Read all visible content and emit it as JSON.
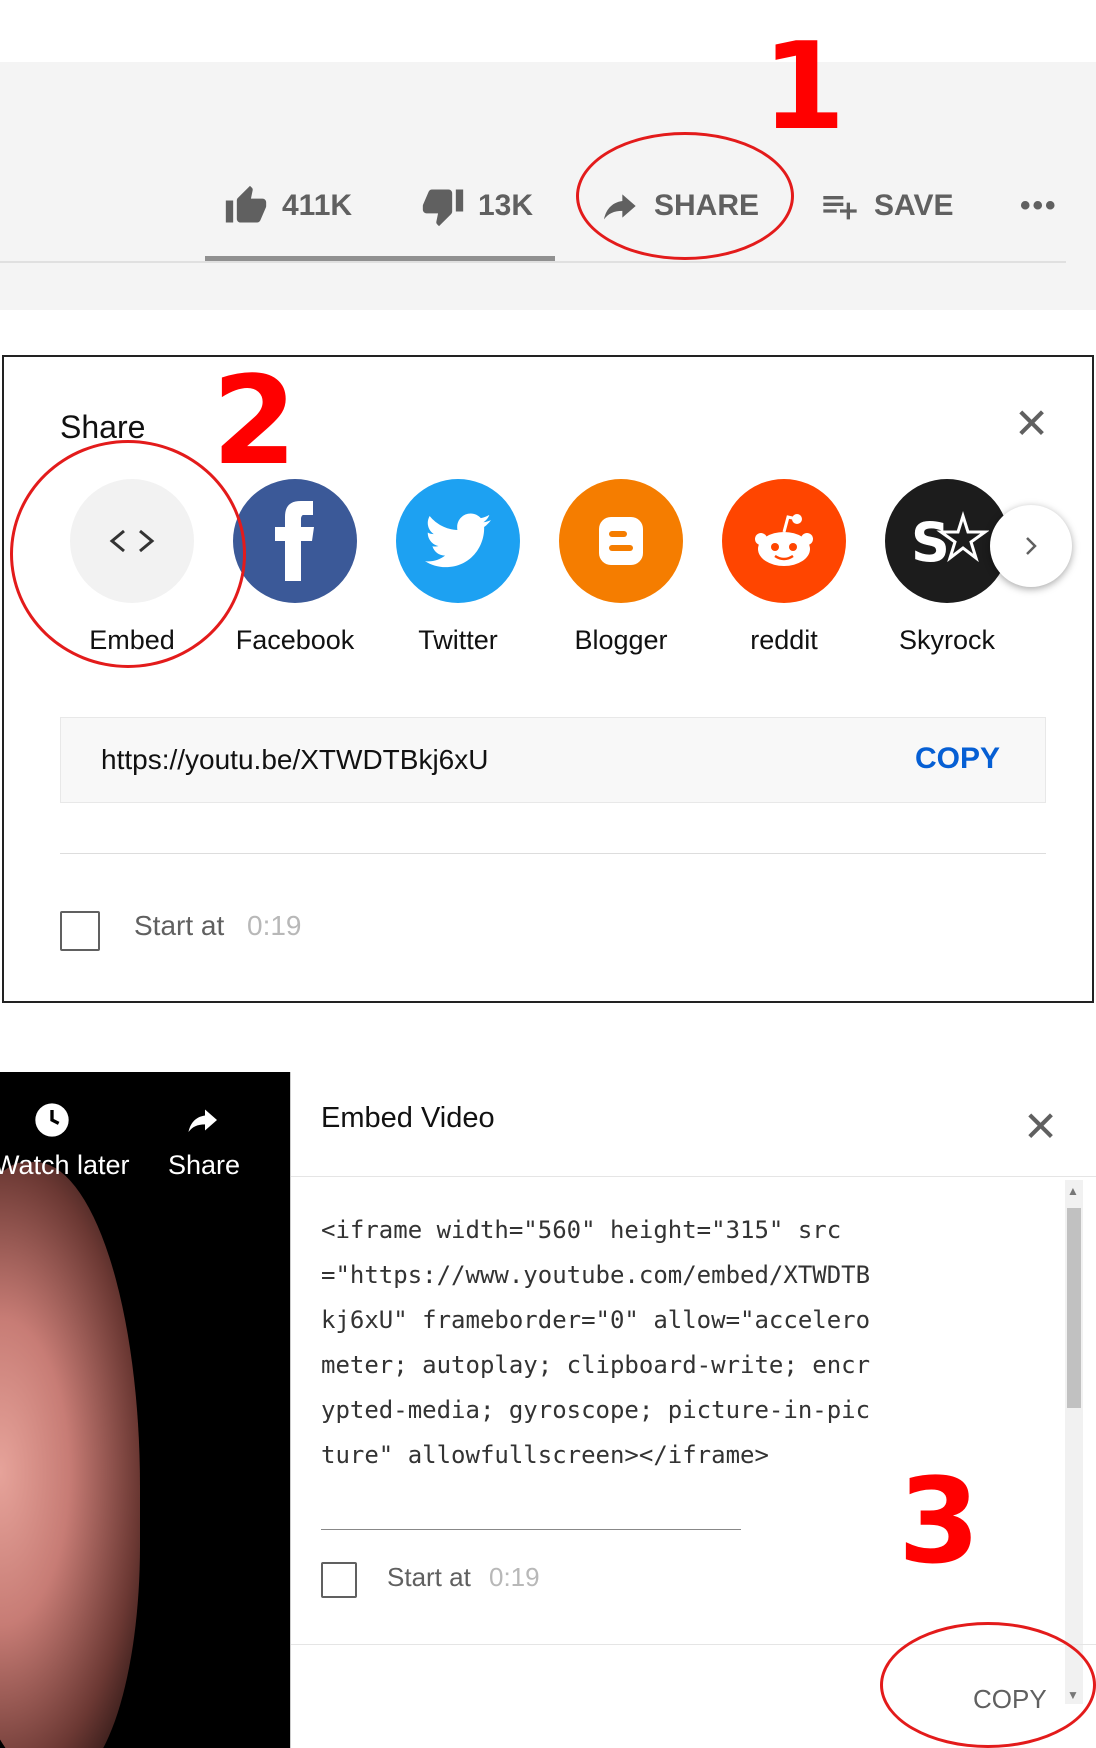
{
  "panel1": {
    "likes": "411K",
    "dislikes": "13K",
    "share_label": "SHARE",
    "save_label": "SAVE",
    "more_label": "•••"
  },
  "share_dialog": {
    "title": "Share",
    "close": "✕",
    "services": [
      {
        "label": "Embed",
        "icon": "embed-code-icon",
        "color": "#f2f2f2"
      },
      {
        "label": "Facebook",
        "icon": "facebook-icon",
        "color": "#3b5998"
      },
      {
        "label": "Twitter",
        "icon": "twitter-icon",
        "color": "#1da1f2"
      },
      {
        "label": "Blogger",
        "icon": "blogger-icon",
        "color": "#f57d00"
      },
      {
        "label": "reddit",
        "icon": "reddit-icon",
        "color": "#ff4500"
      },
      {
        "label": "Skyrock",
        "icon": "skyrock-icon",
        "color": "#1c1c1c"
      }
    ],
    "url": "https://youtu.be/XTWDTBkj6xU",
    "copy_label": "COPY",
    "start_label": "Start at",
    "start_time": "0:19",
    "link_color": "#065fd4"
  },
  "embed_dialog": {
    "player_watch_later": "Watch later",
    "player_share": "Share",
    "title": "Embed Video",
    "close": "✕",
    "code": "<iframe width=\"560\" height=\"315\" src=\"https://www.youtube.com/embed/XTWDTBkj6xU\" frameborder=\"0\" allow=\"accelerometer; autoplay; clipboard-write; encrypted-media; gyroscope; picture-in-picture\" allowfullscreen></iframe>",
    "start_label": "Start at",
    "start_time": "0:19",
    "copy_label": "COPY"
  },
  "annotations": {
    "step1": "1",
    "step2": "2",
    "step3": "3",
    "marker_color": "#ff0000"
  }
}
